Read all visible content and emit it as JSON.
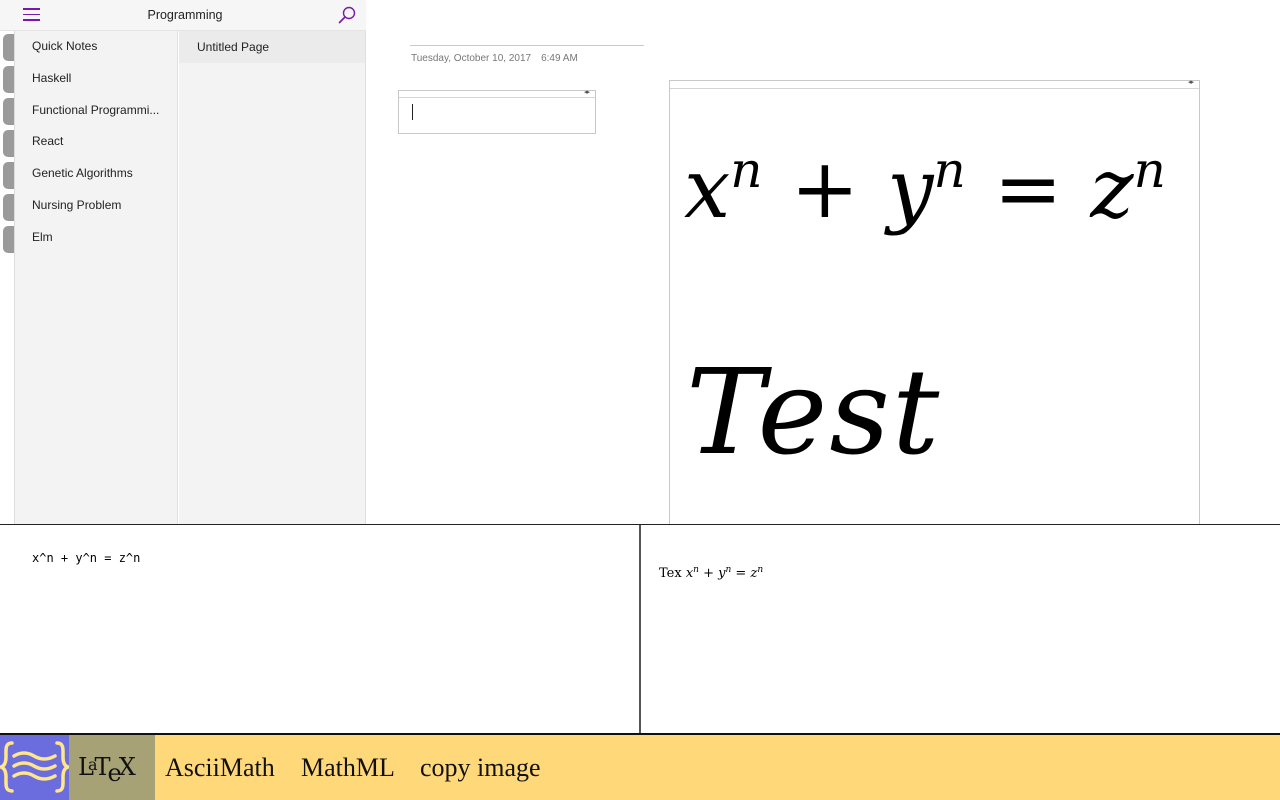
{
  "notebook": {
    "title": "Programming",
    "menu_icon": "hamburger-menu-icon",
    "search_icon": "search-icon",
    "accent_color": "#7719aa"
  },
  "sections": [
    {
      "label": "Quick Notes"
    },
    {
      "label": "Haskell"
    },
    {
      "label": "Functional Programmi..."
    },
    {
      "label": "React"
    },
    {
      "label": "Genetic Algorithms"
    },
    {
      "label": "Nursing Problem"
    },
    {
      "label": "Elm"
    }
  ],
  "pages": [
    {
      "label": "Untitled Page"
    }
  ],
  "page": {
    "date": "Tuesday, October 10, 2017",
    "time": "6:49 AM",
    "rendered_equation": {
      "terms": [
        {
          "base": "x",
          "exp": "n"
        },
        {
          "op": "+"
        },
        {
          "base": "y",
          "exp": "n"
        },
        {
          "op": "="
        },
        {
          "base": "z",
          "exp": "n"
        }
      ]
    },
    "rendered_text": "Test"
  },
  "editor": {
    "source": "x^n + y^n = z^n"
  },
  "preview": {
    "prefix": "Tex",
    "terms": [
      {
        "base": "x",
        "exp": "n"
      },
      {
        "op": "+"
      },
      {
        "base": "y",
        "exp": "n"
      },
      {
        "op": "="
      },
      {
        "base": "z",
        "exp": "n"
      }
    ]
  },
  "toolbar": {
    "logo_icon": "curly-braces-logo-icon",
    "latex_label": "LaTeX",
    "asciimath_label": "AsciiMath",
    "mathml_label": "MathML",
    "copy_image_label": "copy image",
    "background_color": "#ffd87a",
    "logo_color": "#6b6dde",
    "latex_button_color": "#a6a276"
  }
}
